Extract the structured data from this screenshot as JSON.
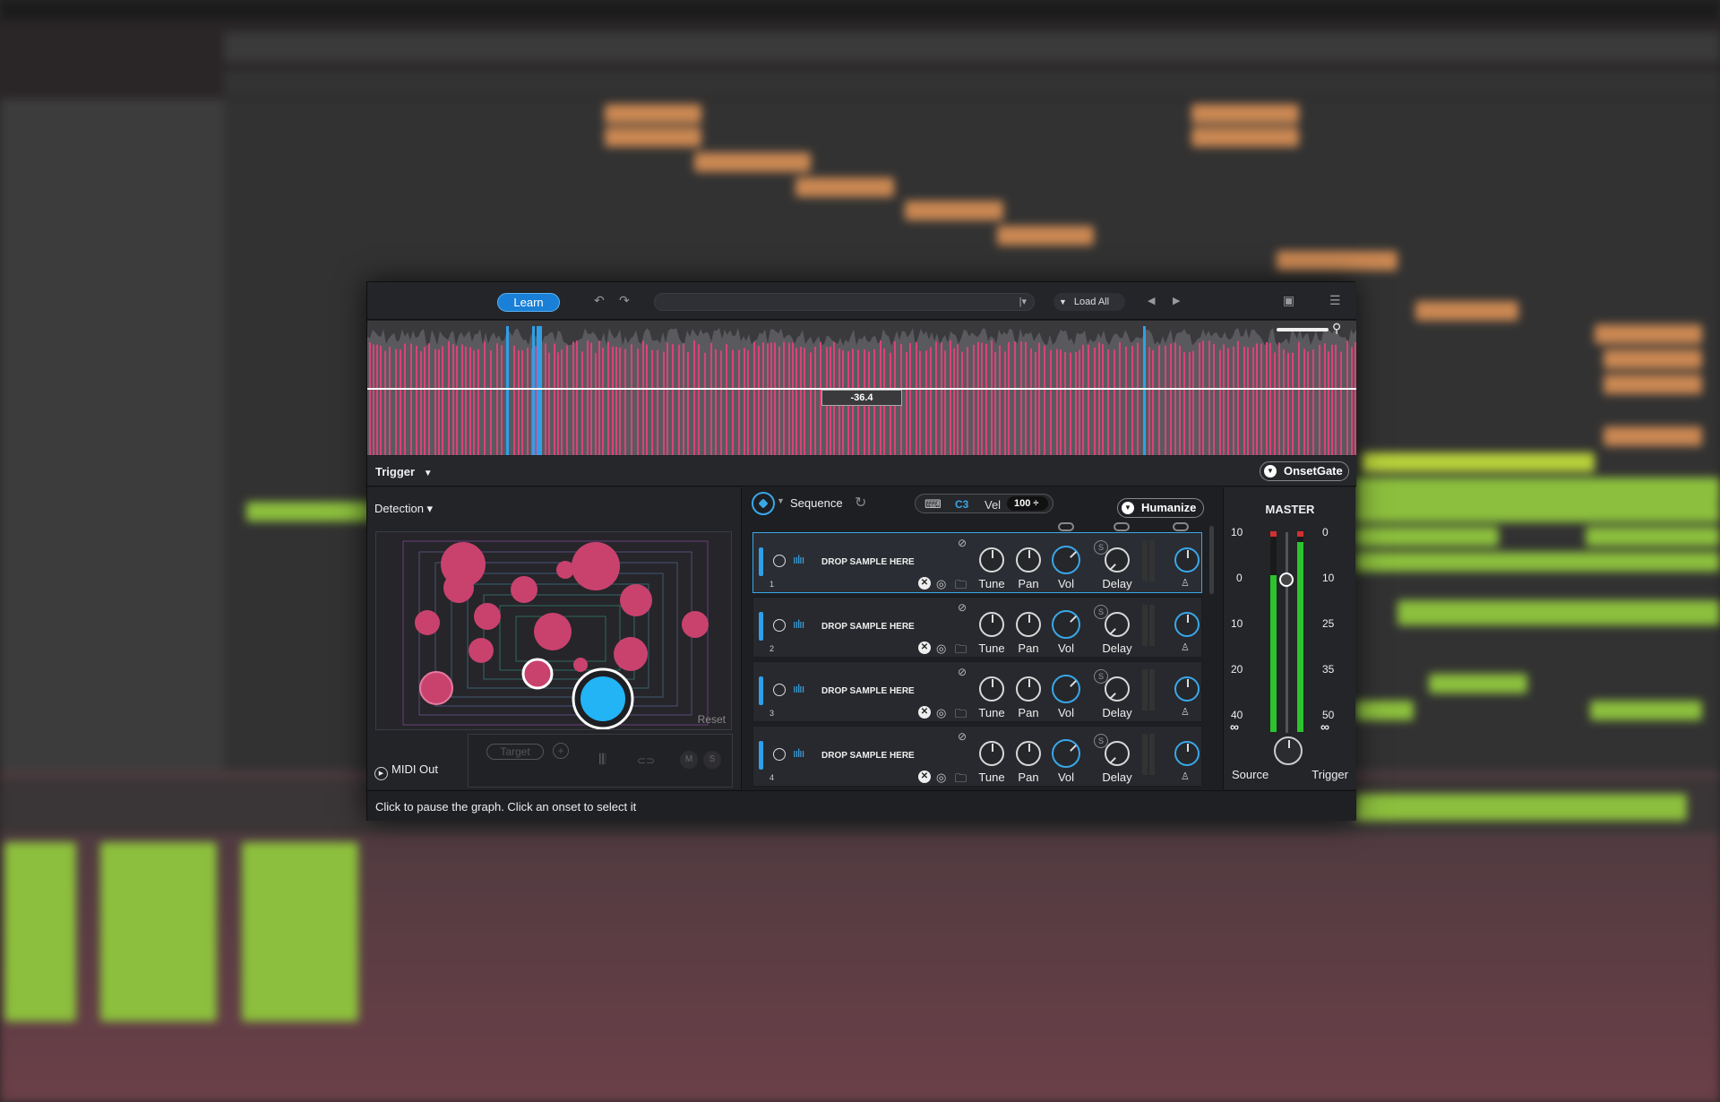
{
  "toolbar": {
    "learn_label": "Learn",
    "undo_icon": "undo-icon",
    "redo_icon": "redo-icon",
    "preset_value": "",
    "preset_arrow": "|▾",
    "load_all_label": "Load All",
    "accent": "#1a7fd6"
  },
  "waveform": {
    "threshold_value": "-36.4",
    "onset_color": "#d94377",
    "selected_color": "#2ea0ea"
  },
  "trigger": {
    "label": "Trigger",
    "arrow": "▼",
    "mode_label": "OnsetGate"
  },
  "detection": {
    "label": "Detection ▾",
    "reset_label": "Reset",
    "midi_out_label": "MIDI Out",
    "target_label": "Target",
    "m_label": "M",
    "s_label": "S"
  },
  "sequence": {
    "label": "Sequence",
    "note": "C3",
    "vel_label": "Vel",
    "vel_value": "100 ÷",
    "humanize_label": "Humanize"
  },
  "slots": [
    {
      "number": "1",
      "drop_label": "DROP SAMPLE HERE",
      "tune_label": "Tune",
      "pan_label": "Pan",
      "vol_label": "Vol",
      "delay_label": "Delay",
      "active": true
    },
    {
      "number": "2",
      "drop_label": "DROP SAMPLE HERE",
      "tune_label": "Tune",
      "pan_label": "Pan",
      "vol_label": "Vol",
      "delay_label": "Delay",
      "active": false
    },
    {
      "number": "3",
      "drop_label": "DROP SAMPLE HERE",
      "tune_label": "Tune",
      "pan_label": "Pan",
      "vol_label": "Vol",
      "delay_label": "Delay",
      "active": false
    },
    {
      "number": "4",
      "drop_label": "DROP SAMPLE HERE",
      "tune_label": "Tune",
      "pan_label": "Pan",
      "vol_label": "Vol",
      "delay_label": "Delay",
      "active": false
    }
  ],
  "master": {
    "title": "MASTER",
    "left_scale": [
      "10",
      "0",
      "10",
      "20",
      "40"
    ],
    "right_scale": [
      "0",
      "10",
      "25",
      "35",
      "50"
    ],
    "infinity": "∞",
    "source_label": "Source",
    "trigger_label": "Trigger",
    "meter_color": "#2dc32d"
  },
  "status": {
    "text": "Click to pause the graph. Click an onset to select it"
  }
}
